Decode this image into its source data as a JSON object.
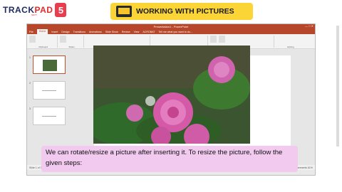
{
  "brand": {
    "name_a": "TRACK",
    "name_b": "PAD",
    "badge": "5",
    "sub": "NEXT"
  },
  "title": "WORKING WITH PICTURES",
  "ppt": {
    "window_title": "Presentation1 - PowerPoint",
    "window_controls": "— □ ✕",
    "tabs": [
      "File",
      "Home",
      "Insert",
      "Design",
      "Transitions",
      "Animations",
      "Slide Show",
      "Review",
      "View",
      "ACROBAT",
      "Tell me what you want to do..."
    ],
    "groups": [
      "Clipboard",
      "Slides",
      "Font",
      "Paragraph",
      "Drawing",
      "Editing"
    ],
    "slide_numbers": [
      "1",
      "2",
      "3"
    ],
    "status_left": "Slide 1 of 3",
    "status_right": "Notes  Comments",
    "zoom": "61%"
  },
  "watermark": "Activate Windows",
  "caption": "We can rotate/resize a picture after inserting it. To resize the picture, follow the given steps:"
}
